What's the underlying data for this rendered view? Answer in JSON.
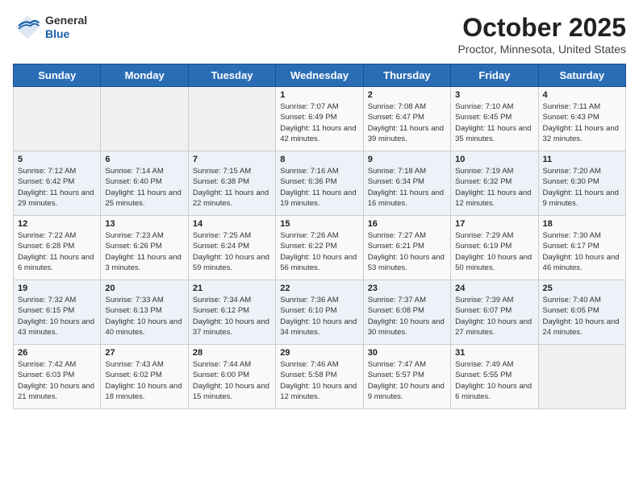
{
  "header": {
    "logo_general": "General",
    "logo_blue": "Blue",
    "title": "October 2025",
    "subtitle": "Proctor, Minnesota, United States"
  },
  "weekdays": [
    "Sunday",
    "Monday",
    "Tuesday",
    "Wednesday",
    "Thursday",
    "Friday",
    "Saturday"
  ],
  "weeks": [
    [
      {
        "day": "",
        "info": ""
      },
      {
        "day": "",
        "info": ""
      },
      {
        "day": "",
        "info": ""
      },
      {
        "day": "1",
        "info": "Sunrise: 7:07 AM\nSunset: 6:49 PM\nDaylight: 11 hours\nand 42 minutes."
      },
      {
        "day": "2",
        "info": "Sunrise: 7:08 AM\nSunset: 6:47 PM\nDaylight: 11 hours\nand 39 minutes."
      },
      {
        "day": "3",
        "info": "Sunrise: 7:10 AM\nSunset: 6:45 PM\nDaylight: 11 hours\nand 35 minutes."
      },
      {
        "day": "4",
        "info": "Sunrise: 7:11 AM\nSunset: 6:43 PM\nDaylight: 11 hours\nand 32 minutes."
      }
    ],
    [
      {
        "day": "5",
        "info": "Sunrise: 7:12 AM\nSunset: 6:42 PM\nDaylight: 11 hours\nand 29 minutes."
      },
      {
        "day": "6",
        "info": "Sunrise: 7:14 AM\nSunset: 6:40 PM\nDaylight: 11 hours\nand 25 minutes."
      },
      {
        "day": "7",
        "info": "Sunrise: 7:15 AM\nSunset: 6:38 PM\nDaylight: 11 hours\nand 22 minutes."
      },
      {
        "day": "8",
        "info": "Sunrise: 7:16 AM\nSunset: 6:36 PM\nDaylight: 11 hours\nand 19 minutes."
      },
      {
        "day": "9",
        "info": "Sunrise: 7:18 AM\nSunset: 6:34 PM\nDaylight: 11 hours\nand 16 minutes."
      },
      {
        "day": "10",
        "info": "Sunrise: 7:19 AM\nSunset: 6:32 PM\nDaylight: 11 hours\nand 12 minutes."
      },
      {
        "day": "11",
        "info": "Sunrise: 7:20 AM\nSunset: 6:30 PM\nDaylight: 11 hours\nand 9 minutes."
      }
    ],
    [
      {
        "day": "12",
        "info": "Sunrise: 7:22 AM\nSunset: 6:28 PM\nDaylight: 11 hours\nand 6 minutes."
      },
      {
        "day": "13",
        "info": "Sunrise: 7:23 AM\nSunset: 6:26 PM\nDaylight: 11 hours\nand 3 minutes."
      },
      {
        "day": "14",
        "info": "Sunrise: 7:25 AM\nSunset: 6:24 PM\nDaylight: 10 hours\nand 59 minutes."
      },
      {
        "day": "15",
        "info": "Sunrise: 7:26 AM\nSunset: 6:22 PM\nDaylight: 10 hours\nand 56 minutes."
      },
      {
        "day": "16",
        "info": "Sunrise: 7:27 AM\nSunset: 6:21 PM\nDaylight: 10 hours\nand 53 minutes."
      },
      {
        "day": "17",
        "info": "Sunrise: 7:29 AM\nSunset: 6:19 PM\nDaylight: 10 hours\nand 50 minutes."
      },
      {
        "day": "18",
        "info": "Sunrise: 7:30 AM\nSunset: 6:17 PM\nDaylight: 10 hours\nand 46 minutes."
      }
    ],
    [
      {
        "day": "19",
        "info": "Sunrise: 7:32 AM\nSunset: 6:15 PM\nDaylight: 10 hours\nand 43 minutes."
      },
      {
        "day": "20",
        "info": "Sunrise: 7:33 AM\nSunset: 6:13 PM\nDaylight: 10 hours\nand 40 minutes."
      },
      {
        "day": "21",
        "info": "Sunrise: 7:34 AM\nSunset: 6:12 PM\nDaylight: 10 hours\nand 37 minutes."
      },
      {
        "day": "22",
        "info": "Sunrise: 7:36 AM\nSunset: 6:10 PM\nDaylight: 10 hours\nand 34 minutes."
      },
      {
        "day": "23",
        "info": "Sunrise: 7:37 AM\nSunset: 6:08 PM\nDaylight: 10 hours\nand 30 minutes."
      },
      {
        "day": "24",
        "info": "Sunrise: 7:39 AM\nSunset: 6:07 PM\nDaylight: 10 hours\nand 27 minutes."
      },
      {
        "day": "25",
        "info": "Sunrise: 7:40 AM\nSunset: 6:05 PM\nDaylight: 10 hours\nand 24 minutes."
      }
    ],
    [
      {
        "day": "26",
        "info": "Sunrise: 7:42 AM\nSunset: 6:03 PM\nDaylight: 10 hours\nand 21 minutes."
      },
      {
        "day": "27",
        "info": "Sunrise: 7:43 AM\nSunset: 6:02 PM\nDaylight: 10 hours\nand 18 minutes."
      },
      {
        "day": "28",
        "info": "Sunrise: 7:44 AM\nSunset: 6:00 PM\nDaylight: 10 hours\nand 15 minutes."
      },
      {
        "day": "29",
        "info": "Sunrise: 7:46 AM\nSunset: 5:58 PM\nDaylight: 10 hours\nand 12 minutes."
      },
      {
        "day": "30",
        "info": "Sunrise: 7:47 AM\nSunset: 5:57 PM\nDaylight: 10 hours\nand 9 minutes."
      },
      {
        "day": "31",
        "info": "Sunrise: 7:49 AM\nSunset: 5:55 PM\nDaylight: 10 hours\nand 6 minutes."
      },
      {
        "day": "",
        "info": ""
      }
    ]
  ]
}
